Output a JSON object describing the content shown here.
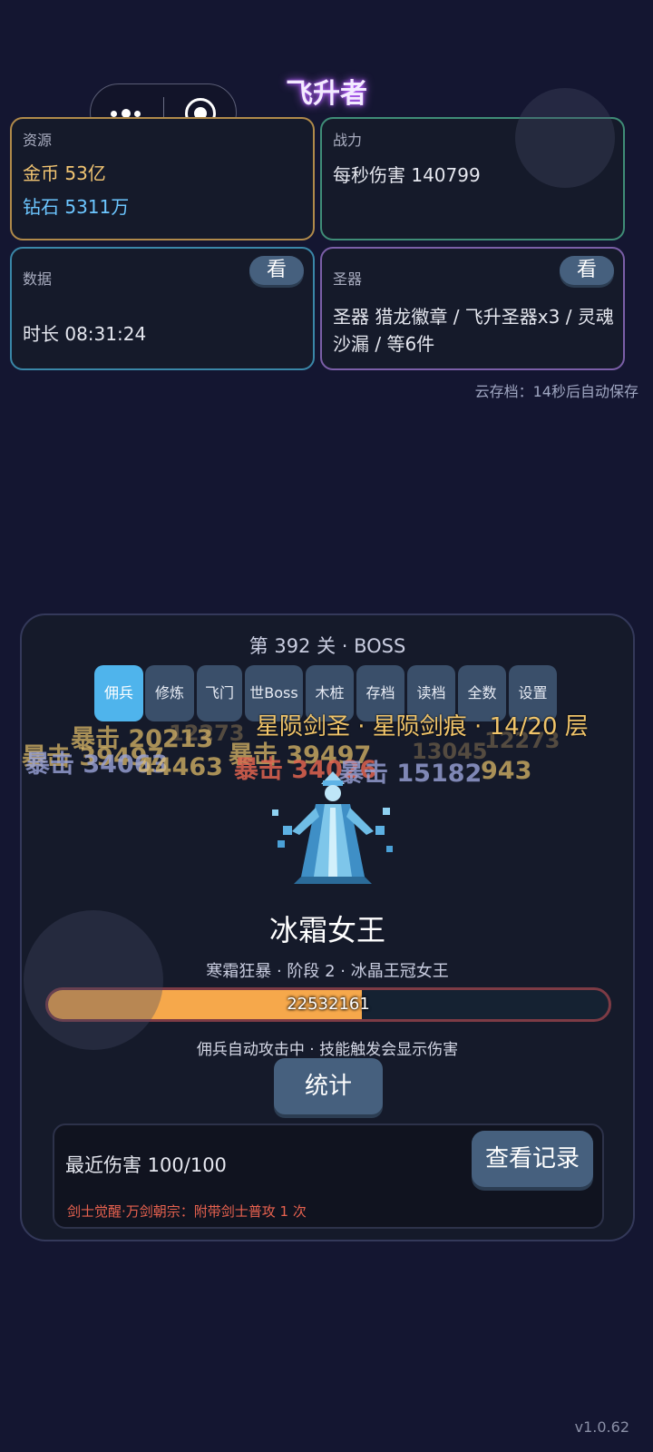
{
  "app": {
    "title": "飞升者",
    "version": "v1.0.62"
  },
  "capsule": {
    "more_icon": "more-dots-icon",
    "close_icon": "target-icon"
  },
  "cards": {
    "resource": {
      "label": "资源",
      "gold": "金币 53亿",
      "diamond": "钻石 5311万"
    },
    "power": {
      "label": "战力",
      "dps": "每秒伤害 140799"
    },
    "stats": {
      "label": "数据",
      "button": "看",
      "duration": "时长 08:31:24"
    },
    "relic": {
      "label": "圣器",
      "button": "看",
      "text": "圣器 猎龙徽章 / 飞升圣器x3 / 灵魂沙漏 / 等6件"
    }
  },
  "cloud_save": "云存档：14秒后自动保存",
  "battle": {
    "level": "第 392 关 · BOSS",
    "tabs": [
      "佣兵",
      "修炼",
      "飞门",
      "世Boss",
      "木桩",
      "存档",
      "读档",
      "全数",
      "设置"
    ],
    "active_tab": "佣兵",
    "tower_progress": "星陨剑圣 · 星陨剑痕 · 14/20 层",
    "damage_popups": [
      {
        "text": "暴击 20213",
        "style": "gold"
      },
      {
        "text": "暴击 39497",
        "style": "gold"
      },
      {
        "text": "暴击 39497",
        "style": "gold"
      },
      {
        "text": "12273",
        "style": "faint"
      },
      {
        "text": "12273",
        "style": "faint"
      },
      {
        "text": "暴击 34063",
        "style": "blue"
      },
      {
        "text": "44463",
        "style": "gold"
      },
      {
        "text": "暴击 34026",
        "style": "red"
      },
      {
        "text": "13045",
        "style": "faint"
      },
      {
        "text": "暴击 15182",
        "style": "blue"
      },
      {
        "text": "943",
        "style": "gold"
      }
    ],
    "boss_name": "冰霜女王",
    "boss_subtitle": "寒霜狂暴 · 阶段 2 · 冰晶王冠女王",
    "hp_text": "22532161",
    "hp_fraction": 0.56,
    "auto_line": "佣兵自动攻击中 · 技能触发会显示伤害",
    "stats_button": "统计",
    "recent_damage": "最近伤害 100/100",
    "record_button": "查看记录",
    "skill_line": "剑士觉醒·万剑朝宗：附带剑士普攻 1 次"
  },
  "colors": {
    "background": "#141631",
    "gold_text": "#f2c572",
    "diamond_text": "#6cc6ff",
    "hp_fill": "#f6a84b",
    "active_tab": "#4fb4ec",
    "button": "#46607e",
    "skill_text": "#e8624f"
  }
}
